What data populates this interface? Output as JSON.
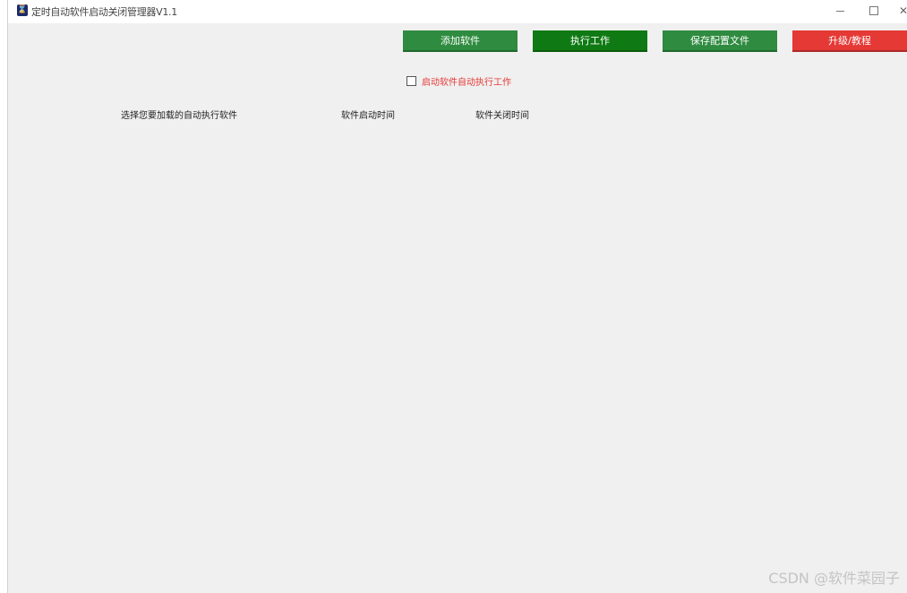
{
  "window": {
    "title": "定时自动软件启动关闭管理器V1.1",
    "icon": "hourglass-icon"
  },
  "toolbar": {
    "add_label": "添加软件",
    "run_label": "执行工作",
    "save_label": "保存配置文件",
    "upgrade_label": "升级/教程"
  },
  "colors": {
    "add_button": "#2e8b3f",
    "run_button": "#0f7a13",
    "save_button": "#2e8b3f",
    "upgrade_button": "#e53935",
    "checkbox_label": "#e53935",
    "title_icon": "#1b2a6b"
  },
  "options": {
    "autorun_label": "启动软件自动执行工作",
    "autorun_checked": false
  },
  "columns": {
    "software": "选择您要加载的自动执行软件",
    "start_time": "软件启动时间",
    "stop_time": "软件关闭时间"
  },
  "watermark": "CSDN @软件菜园子"
}
